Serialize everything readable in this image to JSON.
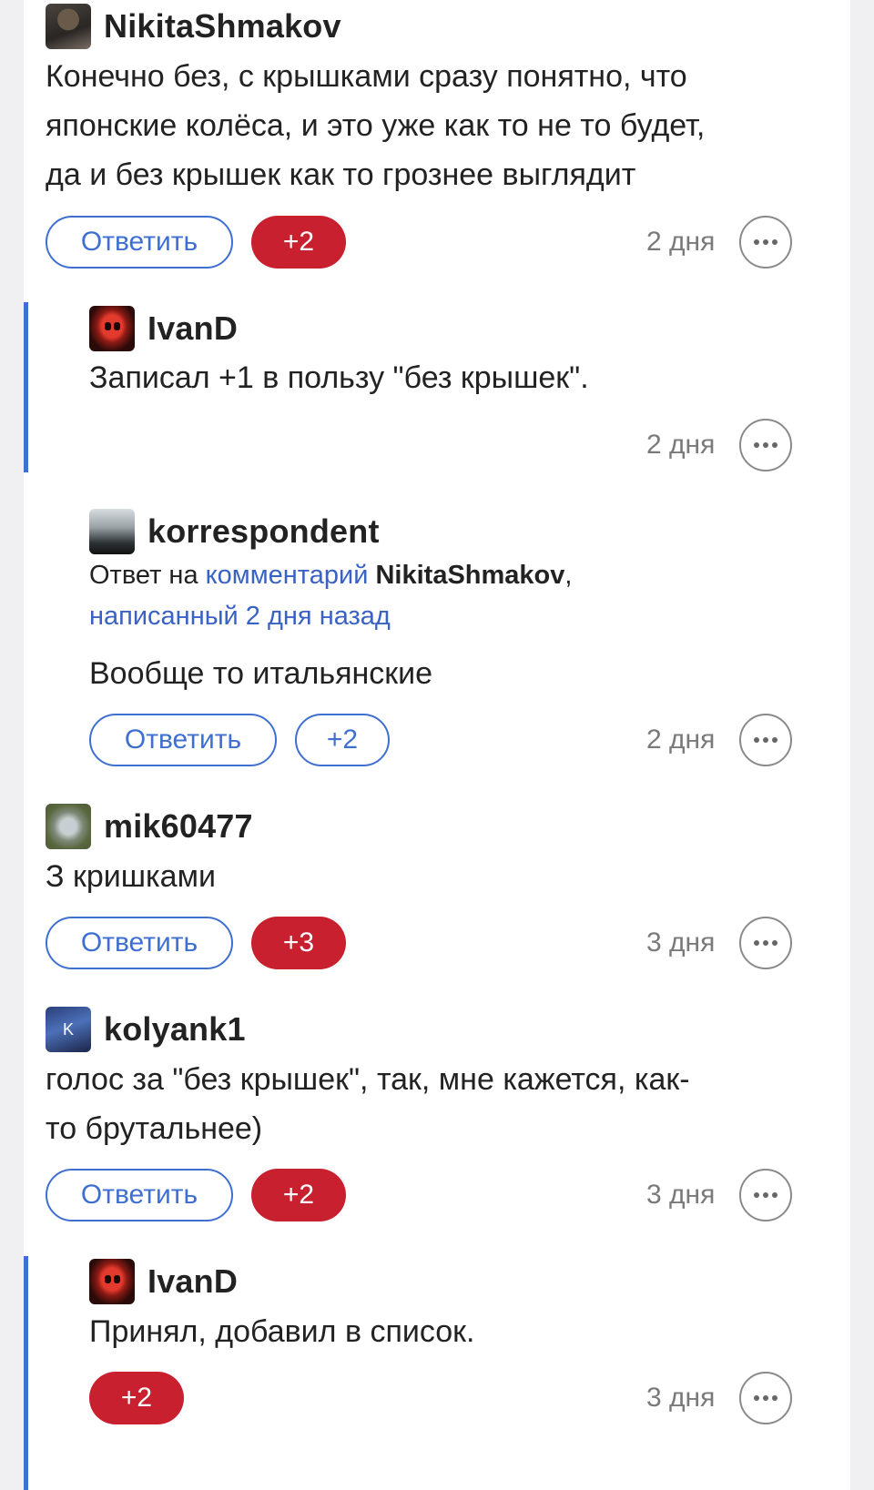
{
  "colors": {
    "accent": "#3f6fd1",
    "vote_active": "#c8202f",
    "muted": "#7a7a7a"
  },
  "reply_label": "Ответить",
  "comments": [
    {
      "author": "NikitaShmakov",
      "text_lines": [
        "Конечно без, с крышками сразу понятно, что",
        "японские колёса, и это уже как то не то будет,",
        "да и без крышек как то грознее выглядит"
      ],
      "votes": "+2",
      "time": "2 дня"
    },
    {
      "author": "IvanD",
      "text_lines": [
        "Записал +1 в пользу \"без крышек\"."
      ],
      "time": "2 дня"
    },
    {
      "author": "korrespondent",
      "reply_to": {
        "prefix": "Ответ на ",
        "link": "комментарий",
        "target": "NikitaShmakov",
        "comma": ",",
        "written": "написанный 2 дня назад"
      },
      "text_lines": [
        "Вообще то итальянские"
      ],
      "votes": "+2",
      "time": "2 дня"
    },
    {
      "author": "mik60477",
      "text_lines": [
        "З кришками"
      ],
      "votes": "+3",
      "time": "3 дня"
    },
    {
      "author": "kolyank1",
      "avatar_letter": "K",
      "text_lines": [
        "голос за \"без крышек\", так, мне кажется, как-",
        "то брутальнее)"
      ],
      "votes": "+2",
      "time": "3 дня"
    },
    {
      "author": "IvanD",
      "text_lines": [
        "Принял, добавил в список."
      ],
      "votes": "+2",
      "time": "3 дня"
    }
  ]
}
